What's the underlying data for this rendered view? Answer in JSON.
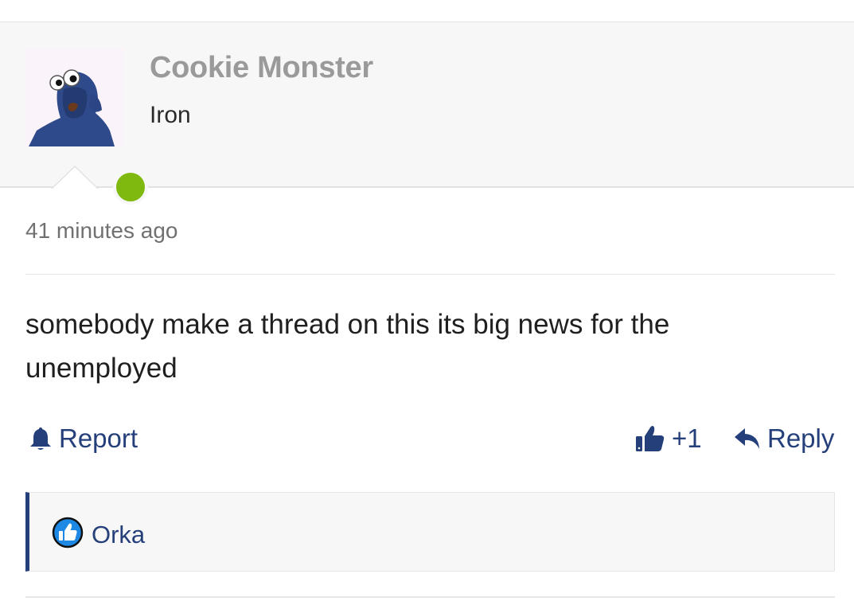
{
  "author": {
    "name": "Cookie Monster",
    "rank": "Iron",
    "online": true
  },
  "post": {
    "timestamp": "41 minutes ago",
    "body": "somebody make a thread on this its big news for the unemployed"
  },
  "actions": {
    "report_label": "Report",
    "like_count": "+1",
    "reply_label": "Reply"
  },
  "reactions": {
    "users": [
      "Orka"
    ]
  },
  "colors": {
    "accent": "#243f7a",
    "online": "#7fb80e",
    "header_bg": "#f7f7f7",
    "author_name": "#9a9a9a"
  },
  "icons": {
    "report": "bell-icon",
    "like": "thumbs-up-icon",
    "reply": "reply-arrow-icon",
    "reaction": "thumbs-up-badge-icon"
  }
}
